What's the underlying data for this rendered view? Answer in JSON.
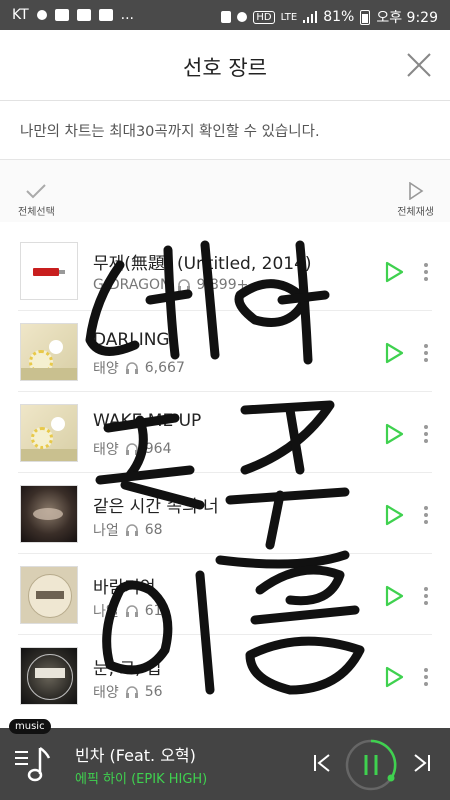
{
  "status_bar": {
    "carrier": "KT",
    "dots": "...",
    "hd": "HD",
    "lte": "LTE",
    "battery": "81%",
    "time": "오후 9:29"
  },
  "header": {
    "title": "선호 장르"
  },
  "notice": {
    "text": "나만의 차트는 최대30곡까지 확인할 수 있습니다."
  },
  "toolbar": {
    "select_all": "전체선택",
    "play_all": "전체재생"
  },
  "songs": [
    {
      "title": "무제(無題) (Untitled, 2014)",
      "artist": "G-DRAGON",
      "plays": "9,899+"
    },
    {
      "title": "DARLING",
      "artist": "태양",
      "plays": "6,667"
    },
    {
      "title": "WAKE ME UP",
      "artist": "태양",
      "plays": "964"
    },
    {
      "title": "같은 시간 속의 너",
      "artist": "나얼",
      "plays": "68"
    },
    {
      "title": "바람기억",
      "artist": "나얼",
      "plays": "61"
    },
    {
      "title": "눈, 코, 입",
      "artist": "태양",
      "plays": "56"
    }
  ],
  "now_playing": {
    "tag": "music",
    "title": "빈차 (Feat. 오혁)",
    "artist": "에픽 하이 (EPIK HIGH)"
  },
  "colors": {
    "accent": "#3fd14f",
    "player_bg": "#444444",
    "status_bg": "#4a4a4a"
  },
  "icons": [
    "close-icon",
    "check-icon",
    "play-outline-icon",
    "headphones-icon",
    "more-vertical-icon",
    "music-note-icon",
    "prev-icon",
    "pause-icon",
    "next-icon"
  ]
}
